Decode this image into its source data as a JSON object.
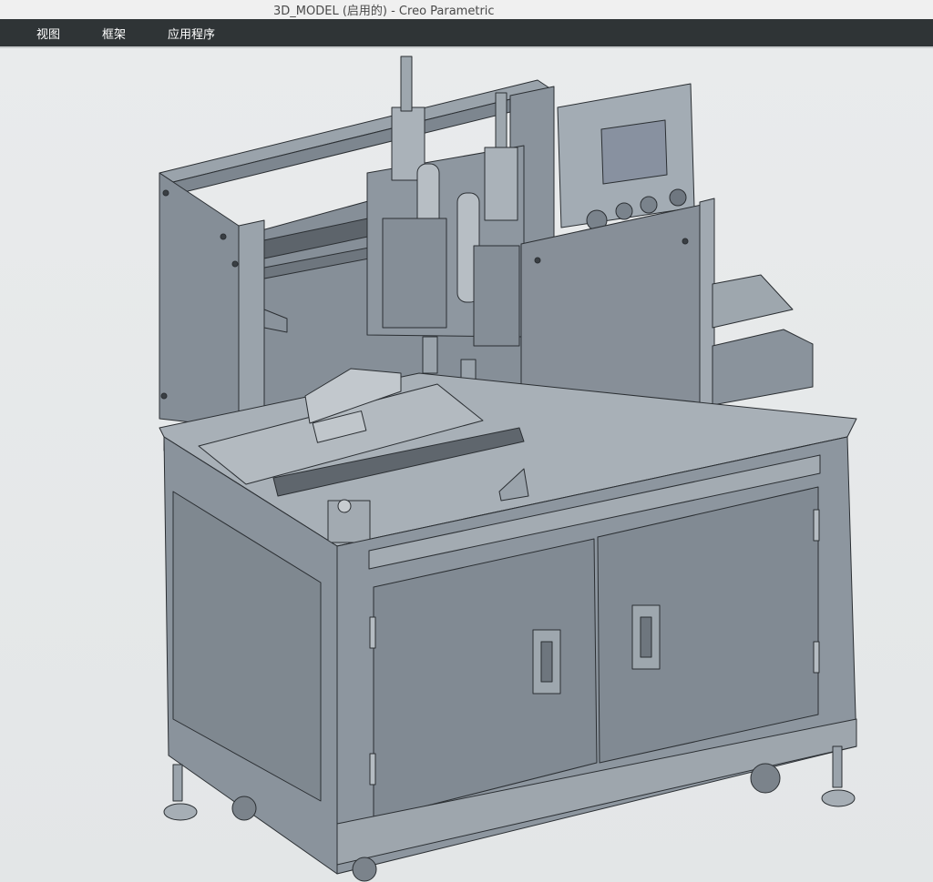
{
  "window": {
    "title": "3D_MODEL (启用的) - Creo Parametric"
  },
  "menubar": {
    "items": [
      {
        "label": "视图"
      },
      {
        "label": "框架"
      },
      {
        "label": "应用程序"
      }
    ]
  },
  "viewport": {
    "content": "3d-model-render",
    "background_color": "#e7e9ea",
    "model_color": "#8b95a0",
    "edge_color": "#2b2f33"
  }
}
